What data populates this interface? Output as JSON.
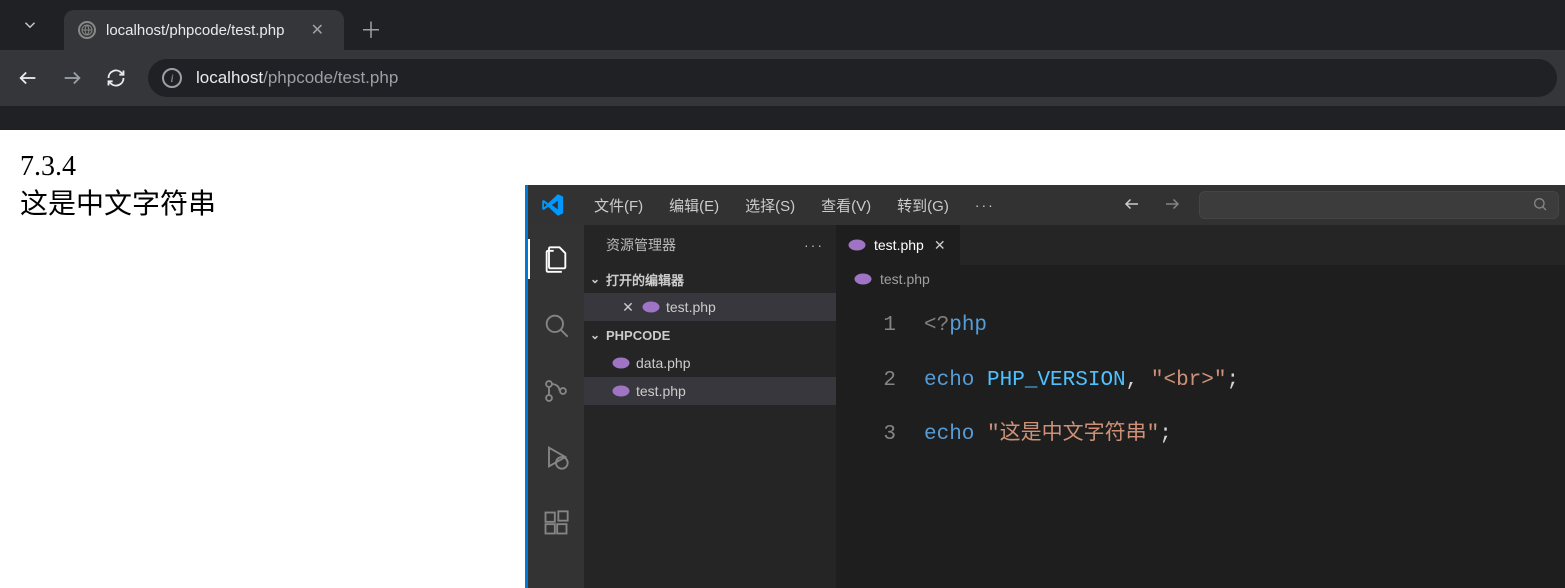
{
  "browser": {
    "tab_title": "localhost/phpcode/test.php",
    "url_host": "localhost",
    "url_path": "/phpcode/test.php"
  },
  "page": {
    "line1": "7.3.4",
    "line2": "这是中文字符串"
  },
  "vscode": {
    "menu": {
      "file": "文件(F)",
      "edit": "编辑(E)",
      "select": "选择(S)",
      "view": "查看(V)",
      "go": "转到(G)",
      "more": "···"
    },
    "sidebar": {
      "title": "资源管理器",
      "more": "···",
      "open_editors_label": "打开的编辑器",
      "open_editors": [
        {
          "name": "test.php"
        }
      ],
      "folder_label": "PHPCODE",
      "files": [
        {
          "name": "data.php",
          "active": false
        },
        {
          "name": "test.php",
          "active": true
        }
      ]
    },
    "editor": {
      "tab_name": "test.php",
      "breadcrumb": "test.php",
      "code": {
        "l1_open": "<?",
        "l1_php": "php",
        "l2_echo": "echo",
        "l2_const": "PHP_VERSION",
        "l2_comma": ", ",
        "l2_str": "\"<br>\"",
        "l2_semi": ";",
        "l3_echo": "echo",
        "l3_str": "\"这是中文字符串\"",
        "l3_semi": ";"
      },
      "line_numbers": [
        "1",
        "2",
        "3"
      ]
    }
  }
}
